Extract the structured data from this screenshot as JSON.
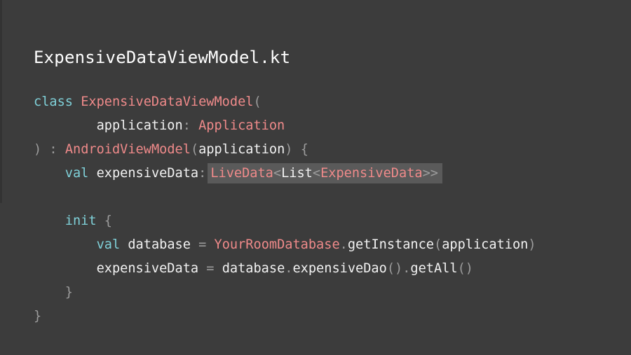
{
  "slide": {
    "file_title": "ExpensiveDataViewModel.kt"
  },
  "code": {
    "line1": {
      "kw": "class",
      "class_name": "ExpensiveDataViewModel",
      "open_paren": "("
    },
    "line2": {
      "param": "application",
      "colon": ":",
      "type": "Application"
    },
    "line3": {
      "close_paren": ")",
      "colon": ":",
      "super_type": "AndroidViewModel",
      "open_paren": "(",
      "arg": "application",
      "close_paren2": ")",
      "brace": "{"
    },
    "line4": {
      "kw": "val",
      "prop": "expensiveData",
      "colon": ":",
      "type_highlighted": {
        "livedata": "LiveData",
        "lt1": "<",
        "list": "List",
        "lt2": "<",
        "expensive_data": "ExpensiveData",
        "gt": ">>"
      }
    },
    "line6": {
      "kw": "init",
      "brace": "{"
    },
    "line7": {
      "kw": "val",
      "var": "database",
      "eq": "=",
      "db_class": "YourRoomDatabase",
      "dot": ".",
      "method": "getInstance",
      "open_paren": "(",
      "arg": "application",
      "close_paren": ")"
    },
    "line8": {
      "target": "expensiveData",
      "eq": "=",
      "obj": "database",
      "dot1": ".",
      "method1": "expensiveDao",
      "parens1": "()",
      "dot2": ".",
      "method2": "getAll",
      "parens2": "()"
    },
    "line9": {
      "brace": "}"
    },
    "line10": {
      "brace": "}"
    }
  },
  "colors": {
    "background": "#3c3c3c",
    "keyword": "#7fd0d8",
    "type": "#ef8a8a",
    "punctuation": "#9c9c9c",
    "identifier": "#f2f2f2",
    "highlight": "#5a5a5a"
  }
}
